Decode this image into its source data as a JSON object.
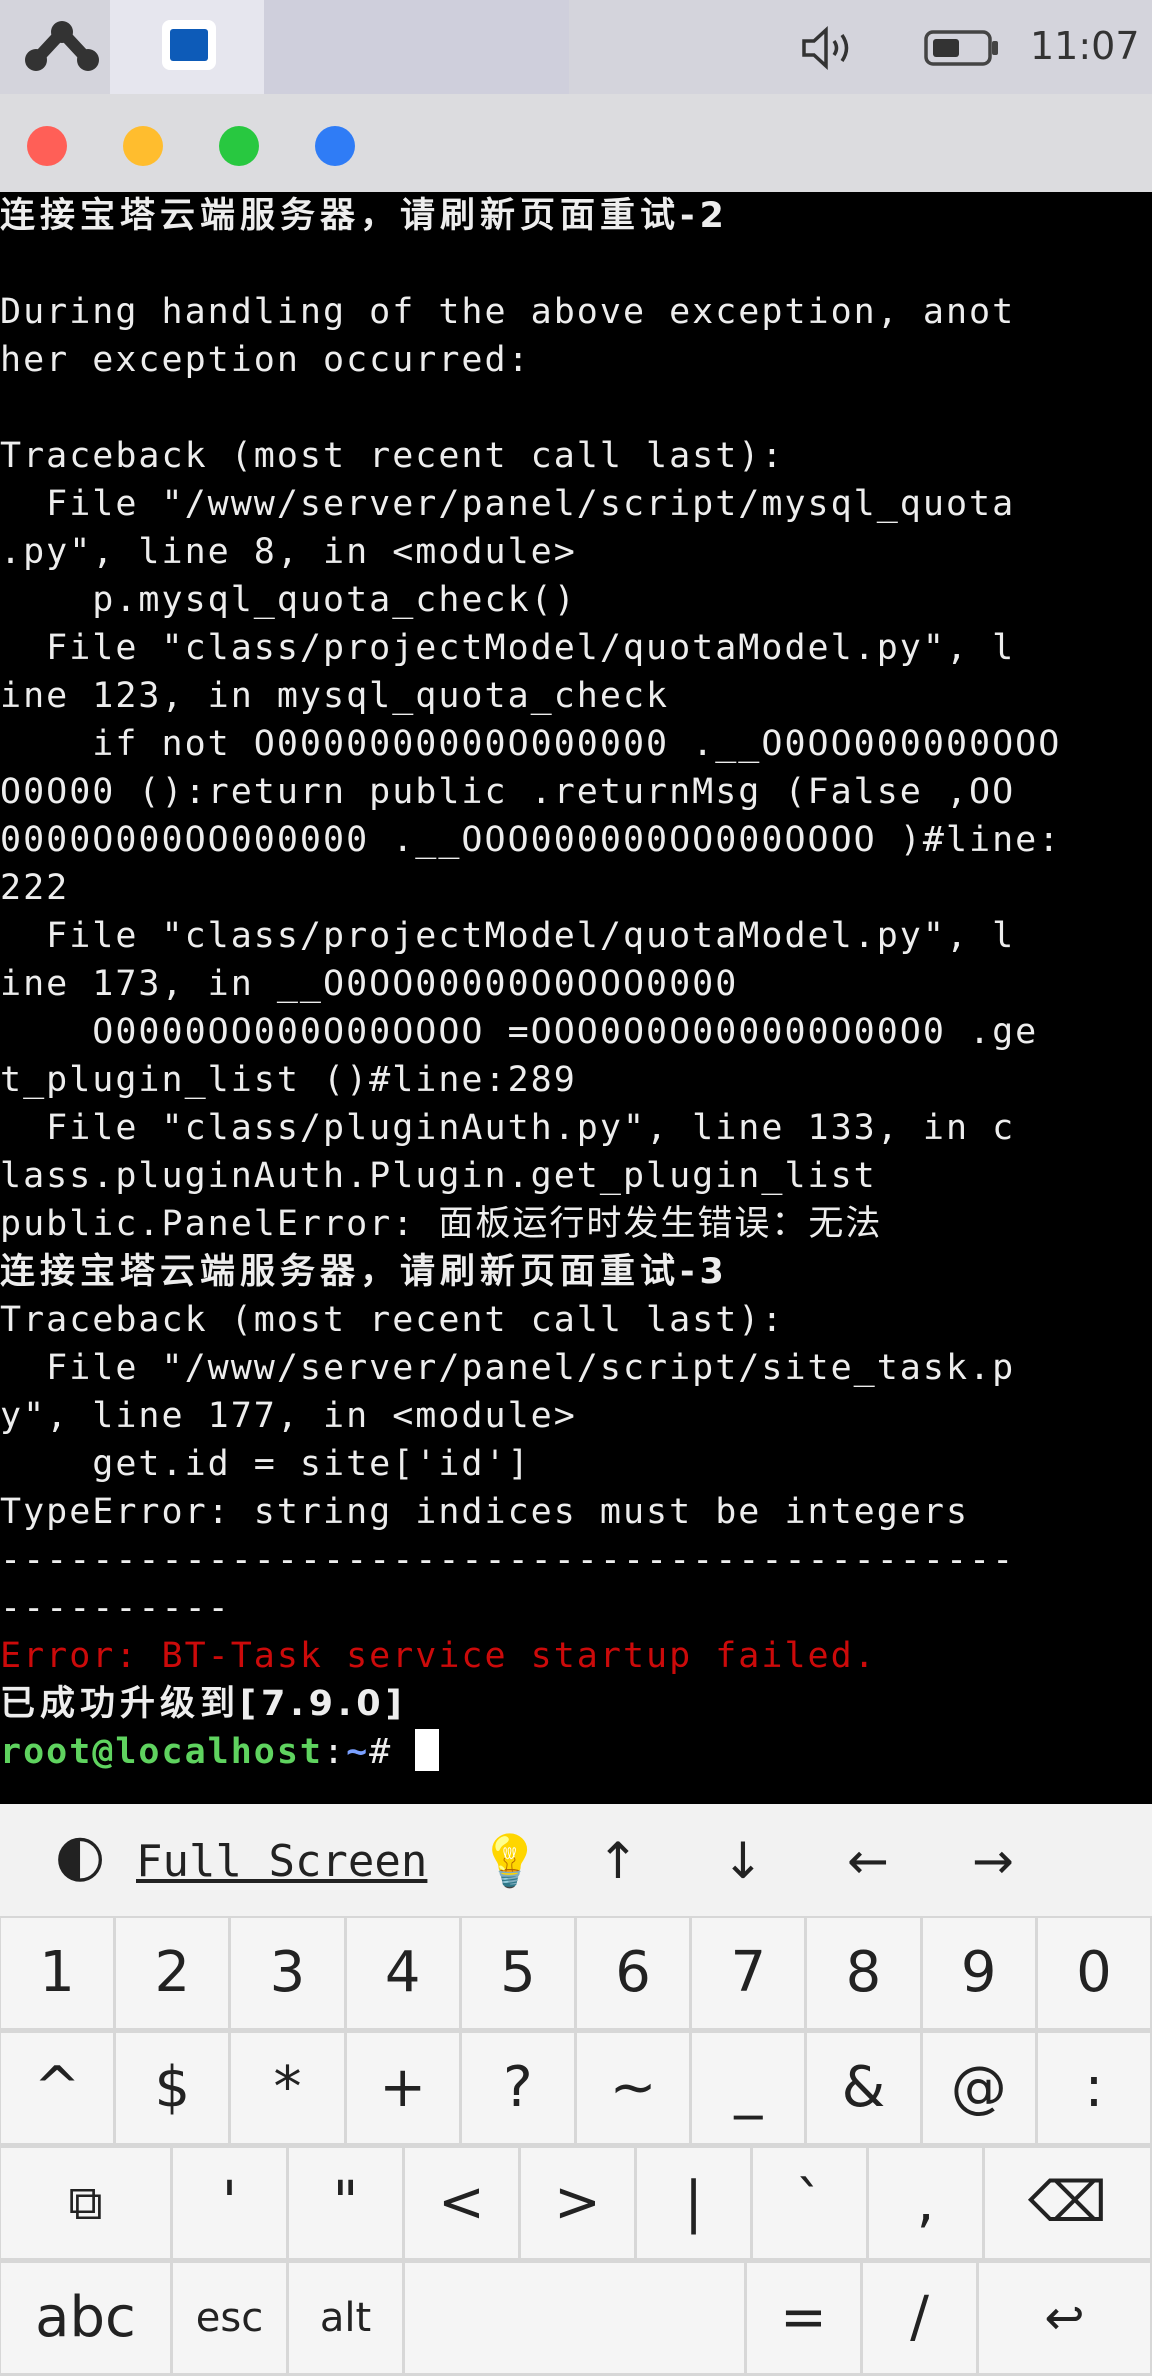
{
  "status_bar": {
    "time": "11:07",
    "icons": [
      "app-logo-icon",
      "terminal-app-icon",
      "volume-icon",
      "battery-icon"
    ]
  },
  "window_controls": [
    {
      "name": "close",
      "color": "#ff5f57"
    },
    {
      "name": "minimize",
      "color": "#ffbd2e"
    },
    {
      "name": "maximize",
      "color": "#28c840"
    },
    {
      "name": "extra",
      "color": "#2f7cf6"
    }
  ],
  "terminal": {
    "lines": [
      {
        "text": "连接宝塔云端服务器，请刷新页面重试-2",
        "style": "cjk"
      },
      {
        "text": "",
        "style": "normal"
      },
      {
        "text": "During handling of the above exception, anot",
        "style": "normal"
      },
      {
        "text": "her exception occurred:",
        "style": "normal"
      },
      {
        "text": "",
        "style": "normal"
      },
      {
        "text": "Traceback (most recent call last):",
        "style": "normal"
      },
      {
        "text": "  File \"/www/server/panel/script/mysql_quota",
        "style": "normal"
      },
      {
        "text": ".py\", line 8, in <module>",
        "style": "normal"
      },
      {
        "text": "    p.mysql_quota_check()",
        "style": "normal"
      },
      {
        "text": "  File \"class/projectModel/quotaModel.py\", l",
        "style": "normal"
      },
      {
        "text": "ine 123, in mysql_quota_check",
        "style": "normal"
      },
      {
        "text": "    if not O0000000000O000000 .__O0OO000000OOO",
        "style": "normal"
      },
      {
        "text": "O0O00 ():return public .returnMsg (False ,OO",
        "style": "normal"
      },
      {
        "text": "0000O000OO000000 .__OOO000000OO000OOOO )#line:",
        "style": "normal"
      },
      {
        "text": "222",
        "style": "normal"
      },
      {
        "text": "  File \"class/projectModel/quotaModel.py\", l",
        "style": "normal"
      },
      {
        "text": "ine 173, in __O0OO00000O0OOO0000",
        "style": "normal"
      },
      {
        "text": "    O0000OO000O00OOOO =OOO0O0O000000O00O0 .ge",
        "style": "normal"
      },
      {
        "text": "t_plugin_list ()#line:289",
        "style": "normal"
      },
      {
        "text": "  File \"class/pluginAuth.py\", line 133, in c",
        "style": "normal"
      },
      {
        "text": "lass.pluginAuth.Plugin.get_plugin_list",
        "style": "normal"
      },
      {
        "text": "public.PanelError: 面板运行时发生错误：无法",
        "style": "normal"
      },
      {
        "text": "连接宝塔云端服务器，请刷新页面重试-3",
        "style": "cjk"
      },
      {
        "text": "Traceback (most recent call last):",
        "style": "normal"
      },
      {
        "text": "  File \"/www/server/panel/script/site_task.p",
        "style": "normal"
      },
      {
        "text": "y\", line 177, in <module>",
        "style": "normal"
      },
      {
        "text": "    get.id = site['id']",
        "style": "normal"
      },
      {
        "text": "TypeError: string indices must be integers",
        "style": "normal"
      },
      {
        "text": "--------------------------------------------",
        "style": "normal"
      },
      {
        "text": "----------",
        "style": "normal"
      },
      {
        "text": "Error: BT-Task service startup failed.",
        "style": "red"
      },
      {
        "text": "已成功升级到[7.9.0]",
        "style": "cjk"
      }
    ],
    "prompt": {
      "user": "root@localhost",
      "sep": ":",
      "path": "~",
      "symbol": "# "
    }
  },
  "extra_keys_bar": {
    "theme_icon": "🌓",
    "fullscreen_label": "Full Screen",
    "bulb_icon": "💡",
    "up": "↑",
    "down": "↓",
    "left": "←",
    "right": "→"
  },
  "keyboard": {
    "row1": [
      "1",
      "2",
      "3",
      "4",
      "5",
      "6",
      "7",
      "8",
      "9",
      "0"
    ],
    "row2": [
      "^",
      "$",
      "*",
      "+",
      "?",
      "~",
      "_",
      "&",
      "@",
      ":"
    ],
    "row3": [
      "⧉",
      "'",
      "\"",
      "<",
      ">",
      "|",
      "`",
      ",",
      "⌫"
    ],
    "row4": [
      "abc",
      "esc",
      "alt",
      "",
      "=",
      "/",
      "↩"
    ]
  }
}
